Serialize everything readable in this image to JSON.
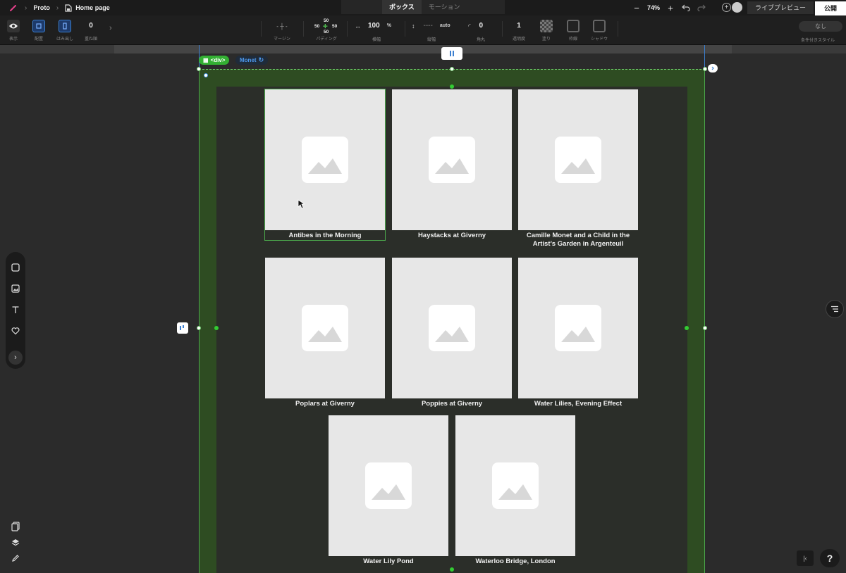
{
  "topbar": {
    "project": "Proto",
    "page": "Home page",
    "tabs": {
      "box": "ボックス",
      "motion": "モーション"
    },
    "zoom": "74%",
    "preview_label": "ライブプレビュー",
    "publish_label": "公開"
  },
  "toolbar": {
    "display_label": "表示",
    "arrange_label": "配置",
    "overflow_label": "はみ出し",
    "stack_label": "重ね順",
    "stack_value": "0",
    "margin_label": "マージン",
    "padding_label": "パディング",
    "padding_top": "50",
    "padding_left": "50",
    "padding_right": "50",
    "padding_bottom": "50",
    "width_value": "100",
    "width_unit": "%",
    "width_label": "横幅",
    "height_value": "----",
    "height_unit": "auto",
    "height_label": "縦幅",
    "radius_value": "0",
    "radius_label": "角丸",
    "opacity_value": "1",
    "opacity_label": "透明度",
    "fill_label": "塗り",
    "border_label": "枠線",
    "shadow_label": "シャドウ",
    "conditional_value": "なし",
    "conditional_label": "条件付きスタイル"
  },
  "canvas": {
    "element_tag": "<div>",
    "component_name": "Monet",
    "cards": [
      {
        "caption": "Antibes in the Morning"
      },
      {
        "caption": "Haystacks at Giverny"
      },
      {
        "caption": "Camille Monet and a Child in the Artist’s Garden in Argenteuil"
      },
      {
        "caption": "Poplars at Giverny"
      },
      {
        "caption": "Poppies at Giverny"
      },
      {
        "caption": "Water Lilies, Evening Effect"
      },
      {
        "caption": "Water Lily Pond"
      },
      {
        "caption": "Waterloo Bridge, London"
      }
    ]
  },
  "colors": {
    "selection_green": "#4ba84b",
    "frame_bg": "#2e4c22",
    "inner_bg": "#2b2e29",
    "thumb_bg": "#e7e7e7",
    "accent_blue": "#3b7fd0"
  },
  "help_label": "?"
}
